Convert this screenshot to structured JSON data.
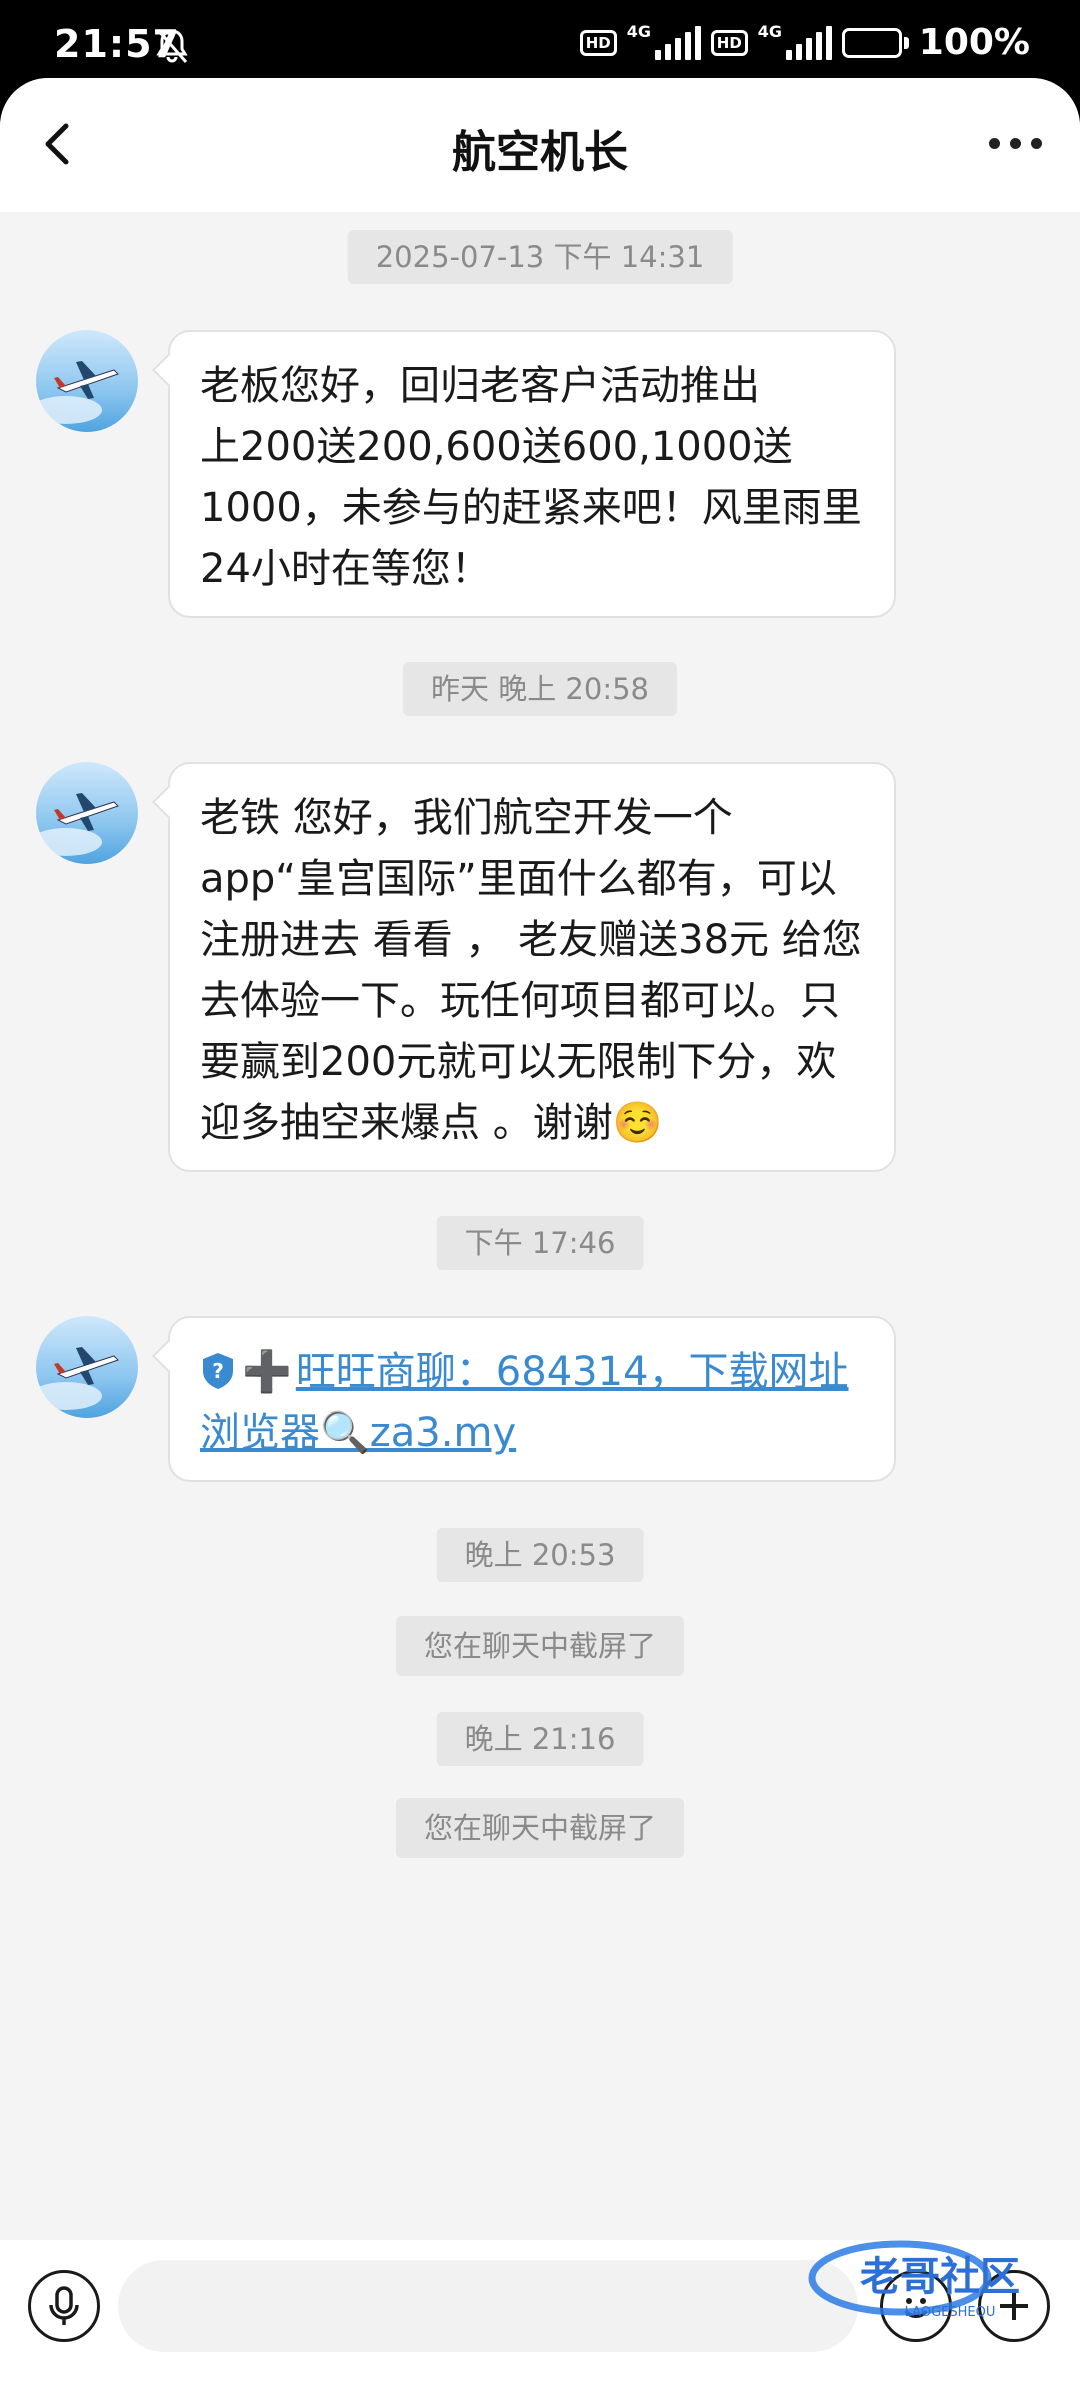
{
  "status_bar": {
    "time": "21:57",
    "sim1": {
      "hd": "HD",
      "net": "4G"
    },
    "sim2": {
      "hd": "HD",
      "net": "4G"
    },
    "battery": "100%"
  },
  "header": {
    "title": "航空机长",
    "back_icon": "chevron-left-icon",
    "more_icon": "more-horizontal-icon"
  },
  "timestamps": {
    "t1": "2025-07-13 下午 14:31",
    "t2": "昨天 晚上 20:58",
    "t3": "下午 17:46",
    "t4": "晚上 20:53",
    "t5": "晚上 21:16"
  },
  "notices": {
    "n1": "您在聊天中截屏了",
    "n2": "您在聊天中截屏了"
  },
  "messages": [
    {
      "text": "老板您好，回归老客户活动推出\n上200送200,600送600,1000送\n1000，未参与的赶紧来吧！风里雨里\n24小时在等您！"
    },
    {
      "text": "老铁 您好，我们航空开发一个\napp“皇宫国际”里面什么都有，可以\n注册进去 看看 ， 老友赠送38元 给您\n去体验一下。玩任何项目都可以。只\n要赢到200元就可以无限制下分，欢\n迎多抽空来爆点 。谢谢☺️"
    },
    {
      "prefix": "➕",
      "link_line1": "旺旺商聊：684314，下载网址",
      "link_line2": "浏览器🔍za3.my"
    }
  ],
  "input": {
    "placeholder": "",
    "voice_icon": "microphone-icon",
    "emoji_icon": "emoji-icon",
    "add_icon": "plus-circle-icon"
  },
  "watermark": {
    "text": "老哥社区",
    "sub": "LAOGESHEQU"
  },
  "colors": {
    "link": "#3a8ad1",
    "background": "#f4f4f4",
    "bubble": "#ffffff",
    "timestamp_bg": "#e6e6e6"
  }
}
